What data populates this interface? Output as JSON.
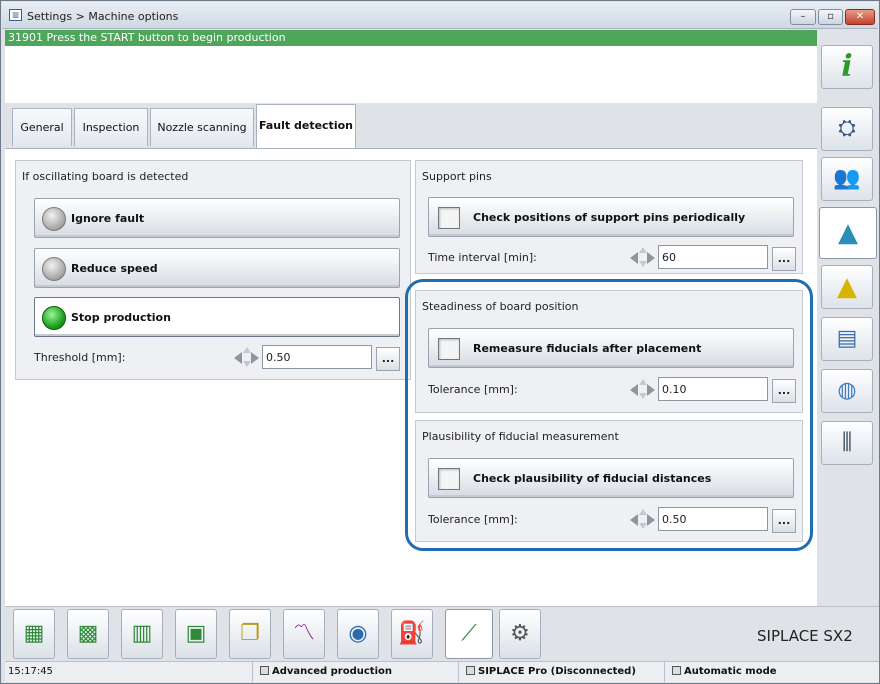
{
  "window": {
    "title": "Settings > Machine options",
    "controls": {
      "minimize": "–",
      "maximize": "▫",
      "close": "✕"
    }
  },
  "status_message": "31901 Press the START button to begin production",
  "tabs": [
    {
      "label": "General",
      "active": false
    },
    {
      "label": "Inspection",
      "active": false
    },
    {
      "label": "Nozzle scanning",
      "active": false
    },
    {
      "label": "Fault detection",
      "active": true
    }
  ],
  "oscillating": {
    "title": "If oscillating board is detected",
    "options": [
      {
        "label": "Ignore fault",
        "selected": false
      },
      {
        "label": "Reduce speed",
        "selected": false
      },
      {
        "label": "Stop production",
        "selected": true
      }
    ],
    "threshold_label": "Threshold [mm]:",
    "threshold_value": "0.50",
    "more_label": "..."
  },
  "support_pins": {
    "title": "Support pins",
    "check_label": "Check positions of support pins periodically",
    "interval_label": "Time interval [min]:",
    "interval_value": "60",
    "more_label": "..."
  },
  "steadiness": {
    "title": "Steadiness of board position",
    "check_label": "Remeasure fiducials after placement",
    "tolerance_label": "Tolerance [mm]:",
    "tolerance_value": "0.10",
    "more_label": "..."
  },
  "plausibility": {
    "title": "Plausibility of fiducial measurement",
    "check_label": "Check plausibility of fiducial distances",
    "tolerance_label": "Tolerance [mm]:",
    "tolerance_value": "0.50",
    "more_label": "..."
  },
  "right_toolbar": [
    {
      "icon": "info-icon"
    },
    {
      "icon": "machine-operator-icon"
    },
    {
      "icon": "users-icon"
    },
    {
      "icon": "machine-options-icon",
      "active": true
    },
    {
      "icon": "warning-icon"
    },
    {
      "icon": "statistics-icon"
    },
    {
      "icon": "globe-icon"
    },
    {
      "icon": "feeder-tools-icon"
    }
  ],
  "bottom_toolbar": [
    {
      "icon": "boards-icon"
    },
    {
      "icon": "grid-icon"
    },
    {
      "icon": "bar-chart-icon"
    },
    {
      "icon": "layout-icon"
    },
    {
      "icon": "documents-icon"
    },
    {
      "icon": "trend-chart-icon"
    },
    {
      "icon": "camera-icon"
    },
    {
      "icon": "oil-can-icon"
    },
    {
      "icon": "service-tool-icon",
      "active": true
    },
    {
      "icon": "settings-hand-icon"
    }
  ],
  "brand": "SIPLACE SX2",
  "footer": {
    "time": "15:17:45",
    "mode_user": "Advanced production",
    "connection": "SIPLACE Pro (Disconnected)",
    "operation": "Automatic mode"
  }
}
